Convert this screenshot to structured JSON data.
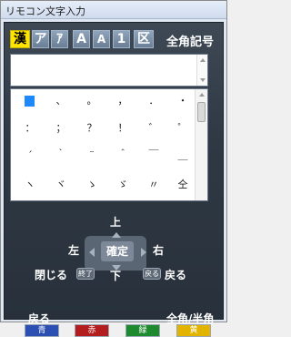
{
  "window": {
    "title": "リモコン文字入力"
  },
  "modes": [
    {
      "label": "漢",
      "active": true
    },
    {
      "label": "ア"
    },
    {
      "label": "ｱ"
    },
    {
      "label": "A"
    },
    {
      "label": "A"
    },
    {
      "label": "1"
    },
    {
      "label": "区"
    }
  ],
  "mode_label": "全角記号",
  "input": {
    "value": ""
  },
  "char_grid": {
    "rows": [
      [
        "",
        "、",
        "。",
        "，",
        "．",
        "・"
      ],
      [
        "：",
        "；",
        "？",
        "！",
        "゛",
        "゜"
      ],
      [
        "´",
        "｀",
        "¨",
        "＾",
        "￣",
        "＿"
      ],
      [
        "ヽ",
        "ヾ",
        "ゝ",
        "ゞ",
        "〃",
        "仝"
      ]
    ]
  },
  "nav": {
    "up": "上",
    "down": "下",
    "left": "左",
    "right": "右",
    "confirm": "確定",
    "close": "閉じる",
    "end_key": "終了",
    "back_key": "戻る",
    "back": "戻る"
  },
  "color_keys": {
    "blue_action": "戻る",
    "yellow_action": "全角/半角",
    "blue": "青",
    "red": "赤",
    "green": "緑",
    "yellow": "黄"
  },
  "colors": {
    "blue": "#2b4fb3",
    "red": "#b31d1d",
    "green": "#1e8a2e",
    "yellow": "#e2b400",
    "active_mode": "#ffe400"
  }
}
